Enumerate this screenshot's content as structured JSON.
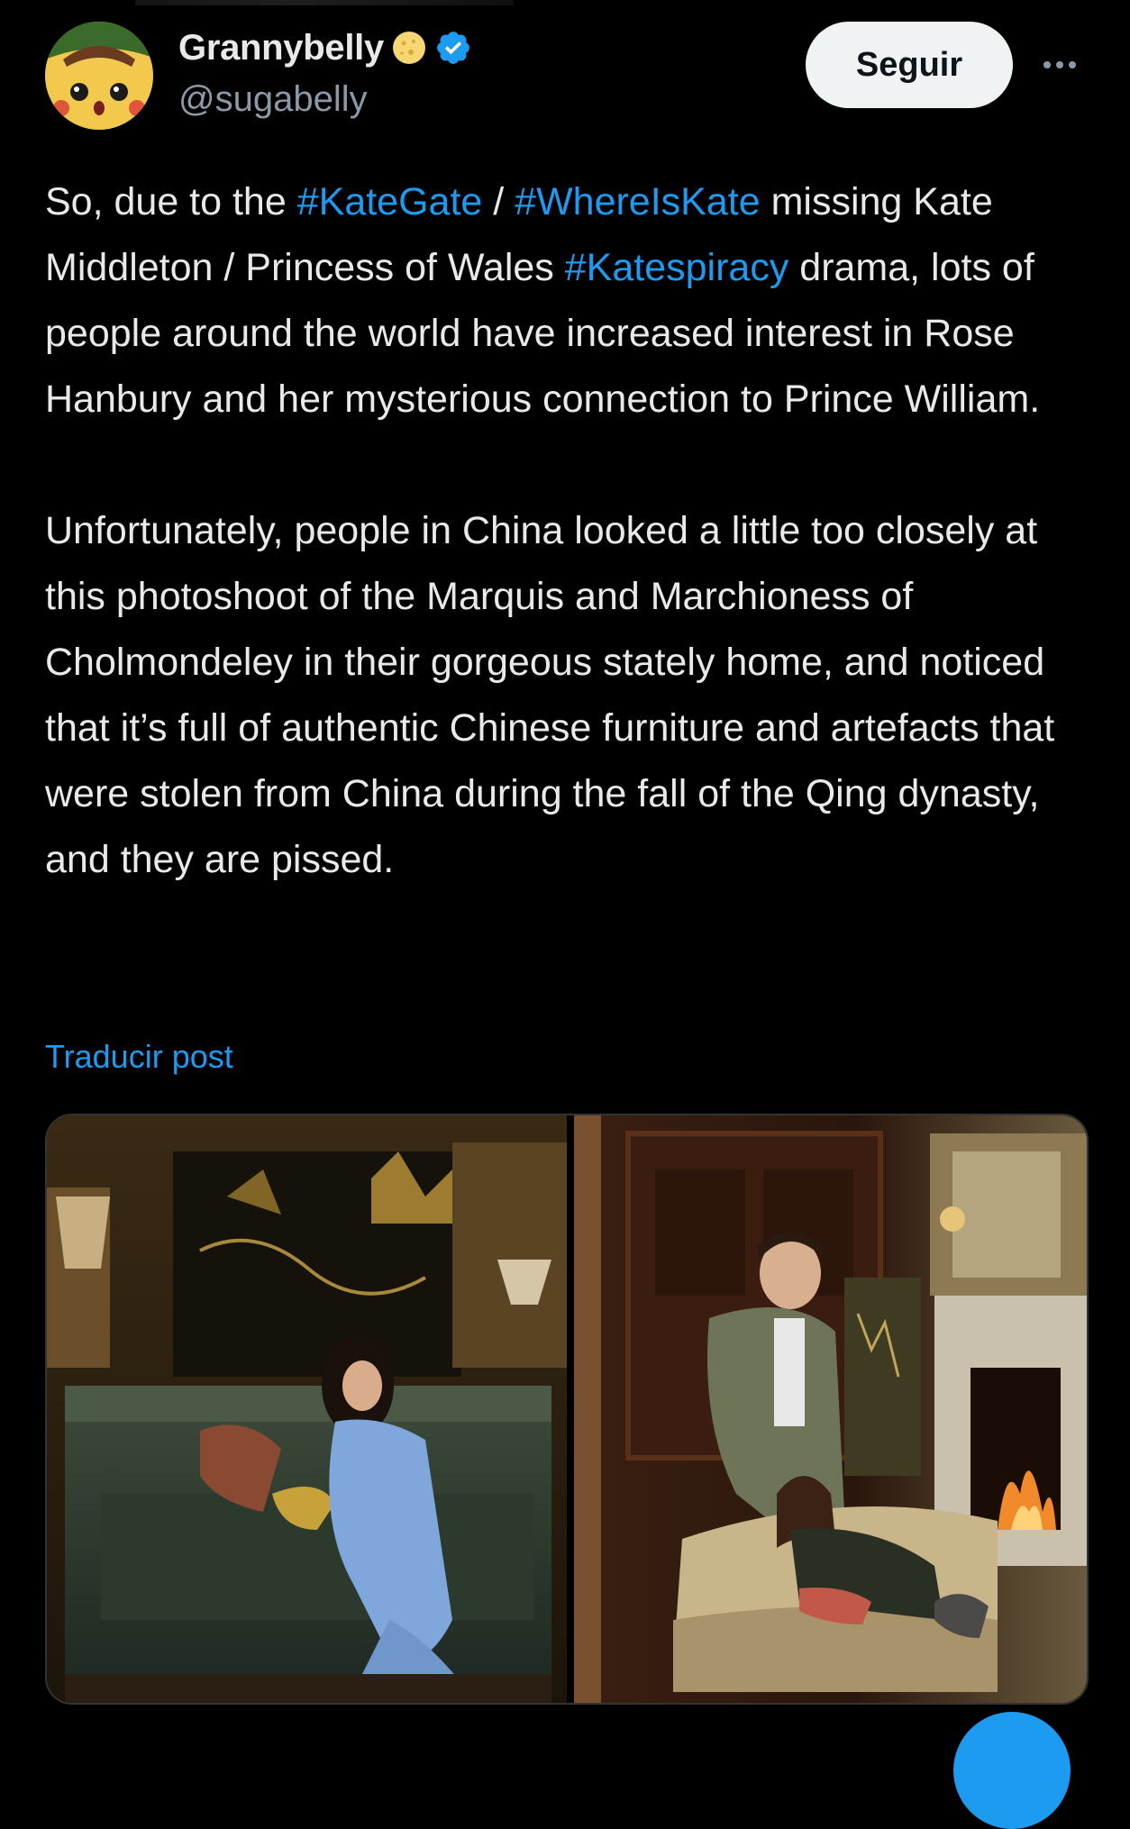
{
  "author": {
    "display_name": "Grannybelly",
    "handle": "@sugabelly",
    "avatar_icon": "surprised-pikachu-avatar",
    "badge_icon": "emoji-badge-icon",
    "verified_icon": "verified-checkmark-icon",
    "verified_color": "#1d9bf0"
  },
  "actions": {
    "follow_label": "Seguir",
    "more_icon": "more-options-icon"
  },
  "post": {
    "paragraph1": {
      "t1": "So, due to the ",
      "tag1": "#KateGate",
      "t2": " / ",
      "tag2": "#WhereIsKate",
      "t3": " missing Kate Middleton / Princess of Wales ",
      "tag3": "#Katespiracy",
      "t4": " drama, lots of people around the world have increased interest in Rose Hanbury and her mysterious connection to Prince William."
    },
    "paragraph2": "Unfortunately, people in China looked a little too closely at this photoshoot of the Marquis and Marchioness of Cholmondeley in their gorgeous stately home, and noticed that it’s full of authentic Chinese furniture and artefacts that were stolen from China during the fall of the Qing dynasty, and they are pissed.",
    "translate_label": "Traducir post"
  },
  "media": {
    "image1_icon": "photo-woman-on-sofa",
    "image2_icon": "photo-couple-by-fireplace"
  },
  "colors": {
    "background": "#000000",
    "text": "#e7e9ea",
    "secondary_text": "#8b98a5",
    "link": "#1d9bf0"
  }
}
